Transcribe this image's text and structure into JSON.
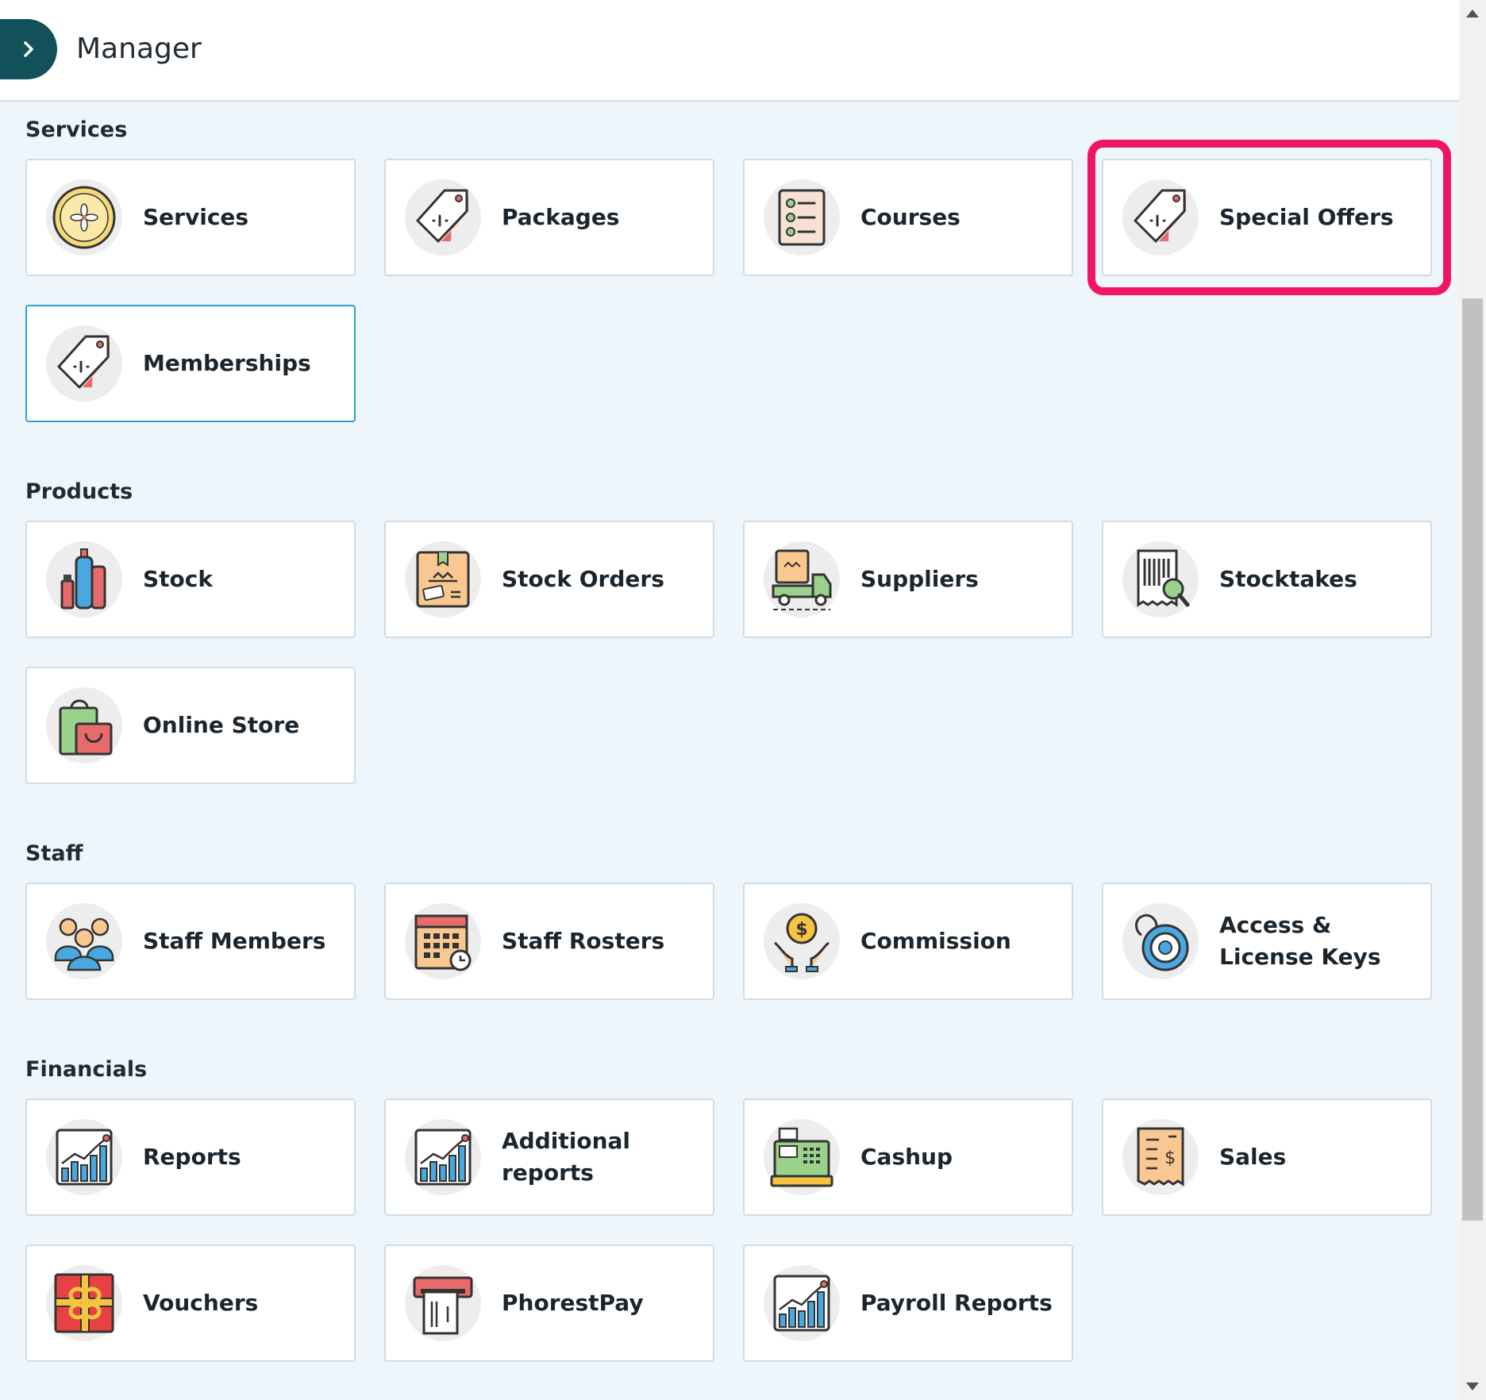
{
  "header": {
    "title": "Manager"
  },
  "sections": {
    "services": {
      "title": "Services",
      "tiles": [
        "Services",
        "Packages",
        "Courses",
        "Special Offers",
        "Memberships"
      ]
    },
    "products": {
      "title": "Products",
      "tiles": [
        "Stock",
        "Stock Orders",
        "Suppliers",
        "Stocktakes",
        "Online Store"
      ]
    },
    "staff": {
      "title": "Staff",
      "tiles": [
        "Staff Members",
        "Staff Rosters",
        "Commission",
        "Access & License Keys"
      ]
    },
    "financials": {
      "title": "Financials",
      "tiles": [
        "Reports",
        "Additional reports",
        "Cashup",
        "Sales",
        "Vouchers",
        "PhorestPay",
        "Payroll Reports"
      ]
    }
  },
  "icons": {
    "services": "flower-clock-icon",
    "packages": "price-tag-icon",
    "courses": "checklist-icon",
    "special_offers": "price-tag-icon",
    "memberships": "price-tag-icon",
    "stock": "cosmetics-icon",
    "stock_orders": "box-icon",
    "suppliers": "delivery-truck-icon",
    "stocktakes": "barcode-search-icon",
    "online_store": "shopping-bags-icon",
    "staff_members": "people-icon",
    "staff_rosters": "calendar-icon",
    "commission": "hands-coin-icon",
    "access_keys": "key-lock-icon",
    "reports": "chart-icon",
    "additional_reports": "chart-icon",
    "cashup": "cash-register-icon",
    "sales": "receipt-icon",
    "vouchers": "gift-icon",
    "phorestpay": "card-terminal-icon",
    "payroll_reports": "chart-icon"
  },
  "colors": {
    "highlight": "#ef1764",
    "header_button": "#12505a",
    "selected_border": "#2aa3c8",
    "page_background": "#eef6fc"
  }
}
